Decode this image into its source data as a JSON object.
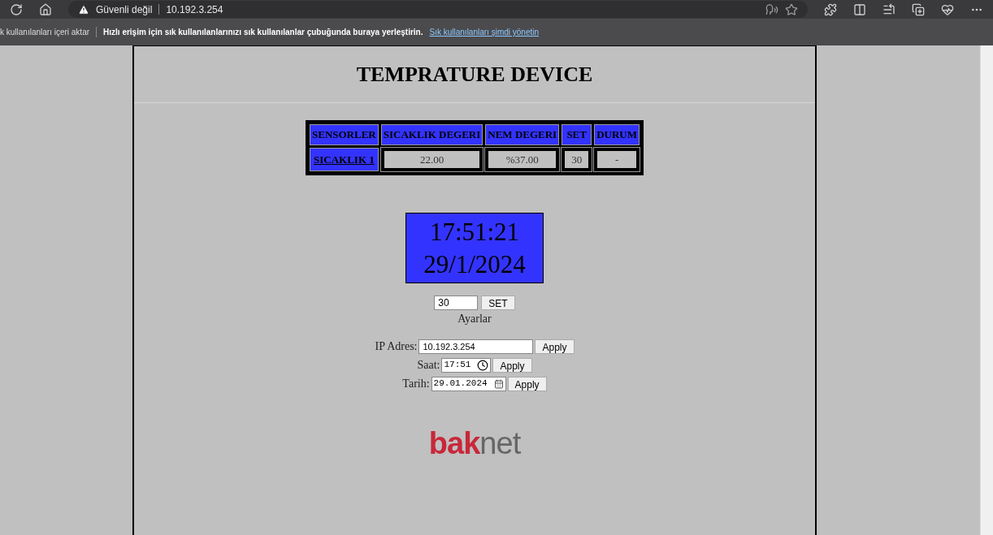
{
  "browser": {
    "security": "Güvenli değil",
    "address": "10.192.3.254"
  },
  "bookmarks_bar": {
    "import": "k kullanılanları içeri aktar",
    "hint": "Hızlı erişim için sık kullanılanlarınızı sık kullanılanlar çubuğunda buraya yerleştirin.",
    "link": "Sık kullanılanları şimdi yönetin"
  },
  "page": {
    "title": "TEMPRATURE DEVICE",
    "table": {
      "columns": [
        "SENSORLER",
        "SICAKLIK DEGERI",
        "NEM DEGERI",
        "SET",
        "DURUM"
      ],
      "rows": [
        [
          "SICAKLIK 1",
          "22.00",
          "%37.00",
          "30",
          "-"
        ]
      ]
    },
    "clock": {
      "time": "17:51:21",
      "date": "29/1/2024"
    },
    "set_form": {
      "value": "30",
      "button": "SET",
      "caption": "Ayarlar"
    },
    "settings": [
      {
        "kind": "text",
        "label": "IP Adres:",
        "value": "10.192.3.254",
        "button": "Apply"
      },
      {
        "kind": "time",
        "label": "Saat:",
        "value": "17:51",
        "button": "Apply"
      },
      {
        "kind": "date",
        "label": "Tarih:",
        "value": "29.01.2024",
        "button": "Apply"
      }
    ],
    "logo": {
      "red": "bak",
      "grey": "net"
    }
  }
}
